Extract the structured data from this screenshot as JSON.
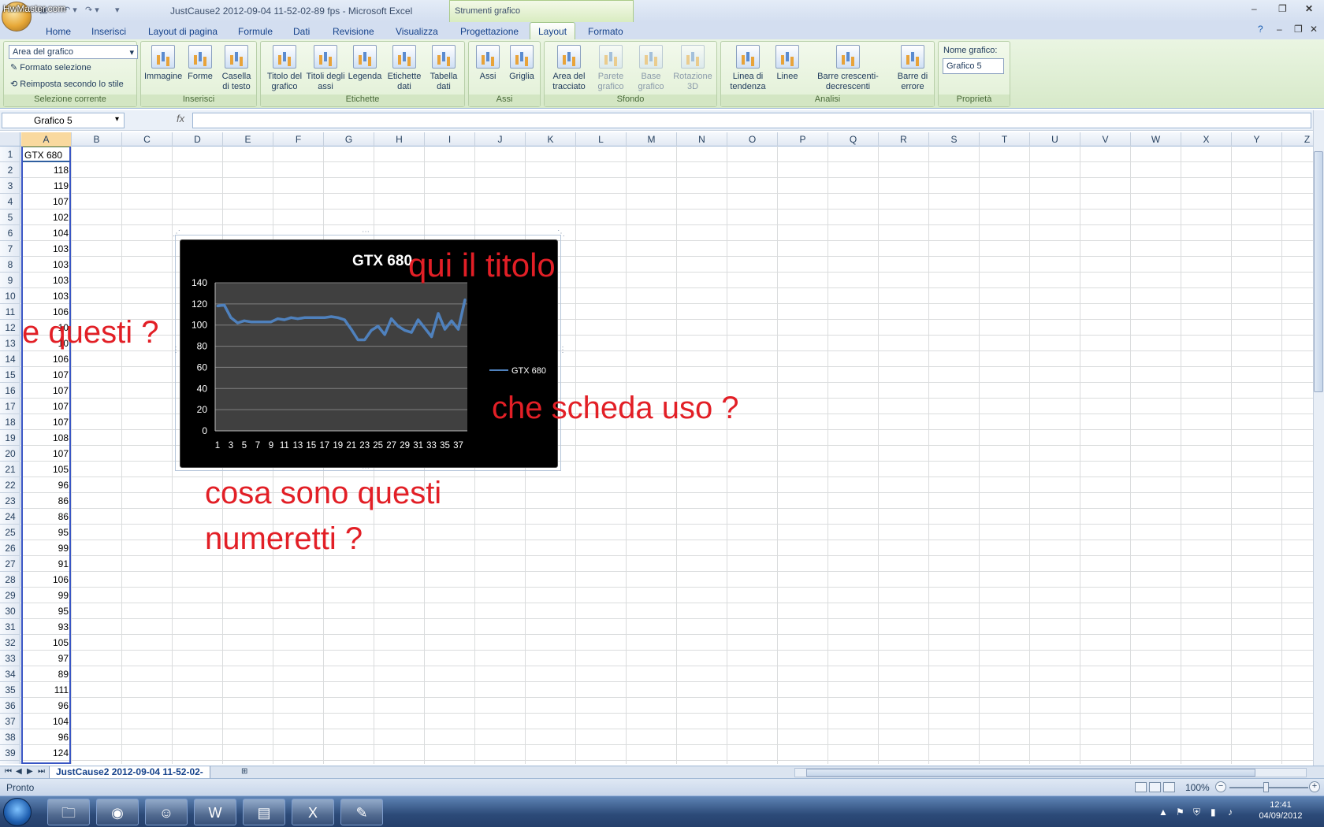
{
  "window": {
    "title": "JustCause2 2012-09-04 11-52-02-89 fps - Microsoft Excel",
    "watermark": "HwMaster.com",
    "contextual_tab": "Strumenti grafico"
  },
  "tabs": [
    "Home",
    "Inserisci",
    "Layout di pagina",
    "Formule",
    "Dati",
    "Revisione",
    "Visualizza",
    "Progettazione",
    "Layout",
    "Formato"
  ],
  "active_tab": "Layout",
  "ribbon": {
    "selection_group": {
      "dropdown_value": "Area del grafico",
      "format_label": "Formato selezione",
      "reset_label": "Reimposta secondo lo stile",
      "label": "Selezione corrente"
    },
    "insert_group": {
      "label": "Inserisci",
      "buttons": [
        "Immagine",
        "Forme",
        "Casella di testo"
      ]
    },
    "labels_group": {
      "label": "Etichette",
      "buttons": [
        "Titolo del grafico",
        "Titoli degli assi",
        "Legenda",
        "Etichette dati",
        "Tabella dati"
      ]
    },
    "axes_group": {
      "label": "Assi",
      "buttons": [
        "Assi",
        "Griglia"
      ]
    },
    "background_group": {
      "label": "Sfondo",
      "buttons": [
        "Area del tracciato",
        "Parete grafico",
        "Base grafico",
        "Rotazione 3D"
      ]
    },
    "analysis_group": {
      "label": "Analisi",
      "buttons": [
        "Linea di tendenza",
        "Linee",
        "Barre crescenti-decrescenti",
        "Barre di errore"
      ]
    },
    "properties_group": {
      "label": "Proprietà",
      "name_label": "Nome grafico:",
      "name_value": "Grafico 5"
    }
  },
  "formula_bar": {
    "name_box": "Grafico 5",
    "fx": "fx",
    "formula": ""
  },
  "columns": [
    "A",
    "B",
    "C",
    "D",
    "E",
    "F",
    "G",
    "H",
    "I",
    "J",
    "K",
    "L",
    "M",
    "N",
    "O",
    "P",
    "Q",
    "R",
    "S",
    "T",
    "U",
    "V",
    "W",
    "X",
    "Y",
    "Z"
  ],
  "rows": [
    "1",
    "2",
    "3",
    "4",
    "5",
    "6",
    "7",
    "8",
    "9",
    "10",
    "11",
    "12",
    "13",
    "14",
    "15",
    "16",
    "17",
    "18",
    "19",
    "20",
    "21",
    "22",
    "23",
    "24",
    "25",
    "26",
    "27",
    "28",
    "29",
    "30",
    "31",
    "32",
    "33",
    "34",
    "35",
    "36",
    "37",
    "38",
    "39"
  ],
  "column_a": {
    "header": "GTX 680",
    "values": [
      "118",
      "119",
      "107",
      "102",
      "104",
      "103",
      "103",
      "103",
      "103",
      "106",
      "10",
      "10",
      "106",
      "107",
      "107",
      "107",
      "107",
      "108",
      "107",
      "105",
      "96",
      "86",
      "86",
      "95",
      "99",
      "91",
      "106",
      "99",
      "95",
      "93",
      "105",
      "97",
      "89",
      "111",
      "96",
      "104",
      "96",
      "124"
    ]
  },
  "chart_data": {
    "type": "line",
    "title": "GTX 680",
    "x": [
      1,
      2,
      3,
      4,
      5,
      6,
      7,
      8,
      9,
      10,
      11,
      12,
      13,
      14,
      15,
      16,
      17,
      18,
      19,
      20,
      21,
      22,
      23,
      24,
      25,
      26,
      27,
      28,
      29,
      30,
      31,
      32,
      33,
      34,
      35,
      36,
      37,
      38
    ],
    "x_tick_labels": [
      "1",
      "3",
      "5",
      "7",
      "9",
      "11",
      "13",
      "15",
      "17",
      "19",
      "21",
      "23",
      "25",
      "27",
      "29",
      "31",
      "33",
      "35",
      "37"
    ],
    "series": [
      {
        "name": "GTX 680",
        "color": "#4f81bd",
        "values": [
          118,
          119,
          107,
          102,
          104,
          103,
          103,
          103,
          103,
          106,
          105,
          107,
          106,
          107,
          107,
          107,
          107,
          108,
          107,
          105,
          96,
          86,
          86,
          95,
          99,
          91,
          106,
          99,
          95,
          93,
          105,
          97,
          89,
          111,
          96,
          104,
          96,
          124
        ]
      }
    ],
    "ylim": [
      0,
      140
    ],
    "y_ticks": [
      "0",
      "20",
      "40",
      "60",
      "80",
      "100",
      "120",
      "140"
    ],
    "legend": "right",
    "grid": true,
    "background": "#000000",
    "plot_area": "#404040"
  },
  "annotations": {
    "title_note": "qui il titolo",
    "rows_note": "e questi ?",
    "legend_note": "che scheda uso ?",
    "axis_note_line1": "cosa sono questi",
    "axis_note_line2": "numeretti ?"
  },
  "sheet_tab": "JustCause2 2012-09-04 11-52-02-",
  "status": {
    "text": "Pronto",
    "zoom": "100%"
  },
  "taskbar": {
    "time": "12:41",
    "date": "04/09/2012"
  }
}
